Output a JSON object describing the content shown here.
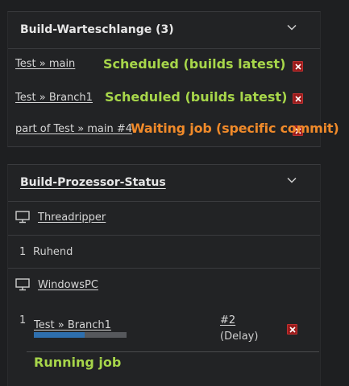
{
  "queue": {
    "title": "Build-Warteschlange (3)",
    "items": [
      {
        "link": "Test » main",
        "annotation": "Scheduled (builds latest)"
      },
      {
        "link": "Test » Branch1",
        "annotation": "Scheduled (builds latest)"
      },
      {
        "link": "part of Test » main #4",
        "annotation": "Waiting job (specific commit)"
      }
    ]
  },
  "executors": {
    "title": "Build-Prozessor-Status",
    "nodes": [
      {
        "name": "Threadripper",
        "executors": [
          {
            "number": "1",
            "status": "Ruhend"
          }
        ]
      },
      {
        "name": "WindowsPC",
        "executors": [
          {
            "number": "1",
            "job": "Test » Branch1",
            "build": "#2",
            "build_note": "(Delay)",
            "progress": 0.55
          }
        ]
      }
    ]
  },
  "annotations": {
    "running": "Running job"
  },
  "colors": {
    "annotation_green": "#a7d64a",
    "annotation_orange": "#f08a2a",
    "stop_red": "#9b1b1b",
    "progress_blue": "#2e6fae"
  }
}
